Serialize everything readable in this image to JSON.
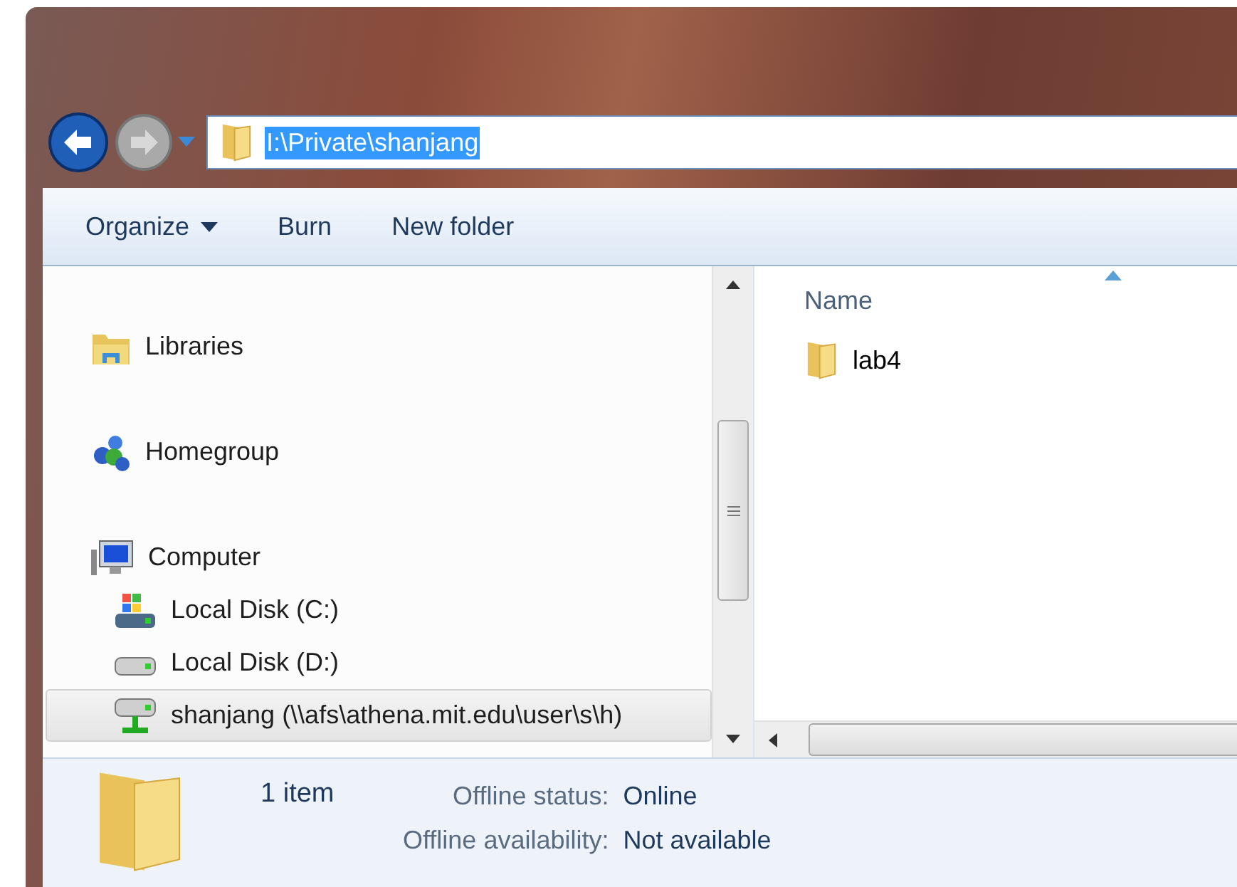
{
  "address_bar": {
    "path": "I:\\Private\\shanjang",
    "selected": true
  },
  "toolbar": [
    {
      "label": "Organize",
      "kind": "menu"
    },
    {
      "label": "Burn",
      "kind": "button"
    },
    {
      "label": "New folder",
      "kind": "button"
    }
  ],
  "navigation": [
    {
      "label": "Libraries",
      "kind": "libraries",
      "selected": false
    },
    {
      "label": "Homegroup",
      "kind": "homegroup",
      "selected": false
    },
    {
      "label": "Computer",
      "kind": "computer",
      "selected": false,
      "children": [
        {
          "label": "Local Disk (C:)",
          "kind": "system-disk",
          "selected": false
        },
        {
          "label": "Local Disk (D:)",
          "kind": "disk",
          "selected": false
        },
        {
          "label": "shanjang (\\\\afs\\athena.mit.edu\\user\\s\\h)",
          "kind": "network-drive",
          "selected": true
        }
      ]
    }
  ],
  "columns": [
    {
      "label": "Name",
      "sorted": true
    }
  ],
  "files": [
    {
      "name": "lab4",
      "selected": false
    }
  ],
  "details": {
    "summary": "1 item",
    "fields": [
      {
        "label": "Offline status:",
        "value": "Online"
      },
      {
        "label": "Offline availability:",
        "value": "Not available"
      }
    ]
  }
}
